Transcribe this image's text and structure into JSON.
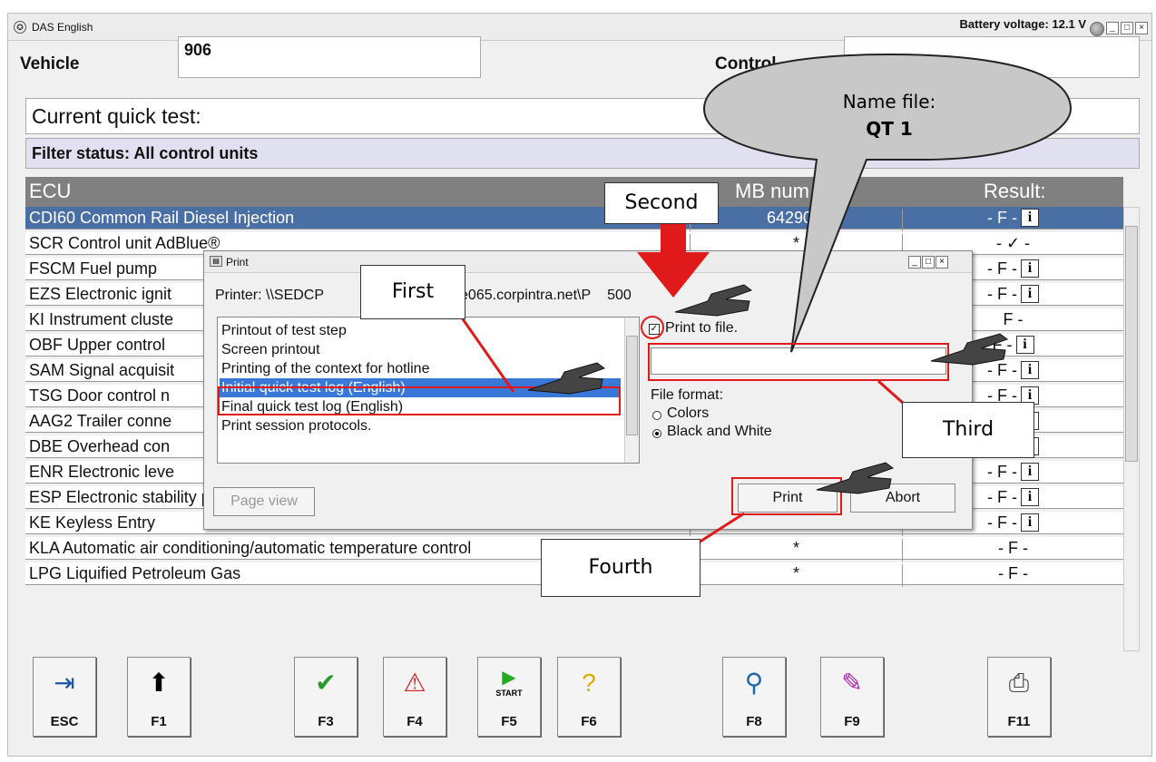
{
  "window": {
    "title": "DAS English",
    "battery": "Battery voltage: 12.1 V",
    "buttons": [
      "_",
      "□",
      "×"
    ]
  },
  "header": {
    "vehicle_label": "Vehicle",
    "vehicle_value": "906",
    "control_label": "Control",
    "quick_test": "Current quick test:",
    "filter": "Filter status: All control units"
  },
  "table": {
    "columns": [
      "ECU",
      "MB num",
      "Result:"
    ],
    "rows": [
      {
        "ecu": "CDI60 Common Rail Diesel Injection",
        "mb": "642901:",
        "result": "- F -",
        "info": true
      },
      {
        "ecu": "SCR Control unit AdBlue®",
        "mb": "*",
        "result": "- ✓ -",
        "info": false
      },
      {
        "ecu": "FSCM Fuel pump",
        "mb": "",
        "result": "- F -",
        "info": true
      },
      {
        "ecu": "EZS Electronic ignit",
        "mb": "",
        "result": "- F -",
        "info": true
      },
      {
        "ecu": "KI Instrument cluste",
        "mb": "",
        "result": "F -",
        "info": false
      },
      {
        "ecu": "OBF Upper control",
        "mb": "",
        "result": "F -",
        "info": true
      },
      {
        "ecu": "SAM Signal acquisit",
        "mb": "",
        "result": "- F -",
        "info": true
      },
      {
        "ecu": "TSG Door control n",
        "mb": "",
        "result": "- F -",
        "info": true
      },
      {
        "ecu": "AAG2 Trailer conne",
        "mb": "",
        "result": "- F -",
        "info": true
      },
      {
        "ecu": "DBE Overhead con",
        "mb": "",
        "result": "- F -",
        "info": true
      },
      {
        "ecu": "ENR Electronic leve",
        "mb": "",
        "result": "- F -",
        "info": true
      },
      {
        "ecu": "ESP Electronic stability program",
        "mb": "*",
        "result": "- F -",
        "info": true
      },
      {
        "ecu": "KE Keyless Entry",
        "mb": "*",
        "result": "- F -",
        "info": true
      },
      {
        "ecu": "KLA Automatic air conditioning/automatic temperature control",
        "mb": "*",
        "result": "- F -",
        "info": false
      },
      {
        "ecu": "LPG Liquified Petroleum Gas",
        "mb": "*",
        "result": "- F -",
        "info": false
      }
    ]
  },
  "toolbar": [
    {
      "label": "ESC",
      "icon": "exit-door-icon"
    },
    {
      "label": "F1",
      "icon": "arrow-up-icon"
    },
    {
      "label": "F3",
      "icon": "checkmark-icon"
    },
    {
      "label": "F4",
      "icon": "info-warning-icon"
    },
    {
      "label": "F5",
      "icon": "start-icon",
      "icon_text": "START"
    },
    {
      "label": "F6",
      "icon": "help-icon"
    },
    {
      "label": "F8",
      "icon": "magnifier-icon"
    },
    {
      "label": "F9",
      "icon": "edit-icon"
    },
    {
      "label": "F11",
      "icon": "printer-icon"
    }
  ],
  "print_dialog": {
    "title": "Print",
    "printer": "Printer: \\\\SEDCP",
    "printer_tail": "e065.corpintra.net\\P",
    "printer_end": "500",
    "options": [
      "Printout of test step",
      "Screen printout",
      "Printing of the context for hotline",
      "Initial quick test log (English)",
      "Final quick test log (English)",
      "Print session protocols."
    ],
    "selected_index": 3,
    "print_to_file": "Print to file.",
    "print_to_file_checked": true,
    "file_format_label": "File format:",
    "format_colors": "Colors",
    "format_bw": "Black and White",
    "selected_format": "Black and White",
    "page_view": "Page view",
    "print_button": "Print",
    "abort_button": "Abort"
  },
  "annotations": {
    "first": "First",
    "second": "Second",
    "third": "Third",
    "fourth": "Fourth",
    "bubble_line1": "Name file:",
    "bubble_line2": "QT 1",
    "highlight_color": "#e01a1a"
  }
}
